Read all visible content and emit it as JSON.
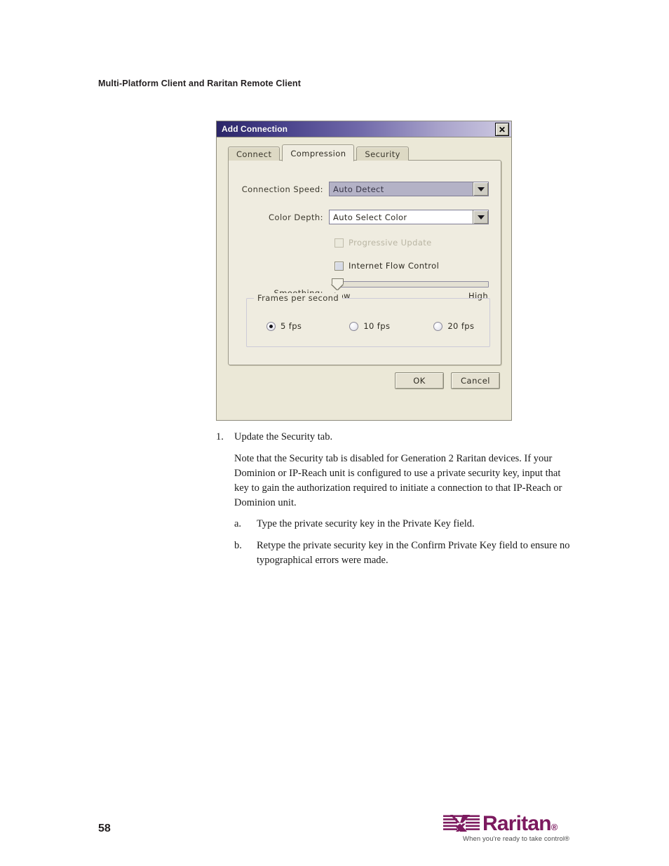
{
  "page": {
    "running_header": "Multi-Platform Client and Raritan Remote Client",
    "page_number": "58"
  },
  "dialog": {
    "title": "Add Connection",
    "close_label": "✕",
    "tabs": [
      {
        "label": "Connect",
        "active": false
      },
      {
        "label": "Compression",
        "active": true
      },
      {
        "label": "Security",
        "active": false
      }
    ],
    "fields": {
      "connection_speed": {
        "label": "Connection Speed:",
        "value": "Auto Detect",
        "state": "disabled"
      },
      "color_depth": {
        "label": "Color Depth:",
        "value": "Auto Select Color",
        "state": "enabled"
      }
    },
    "checkboxes": [
      {
        "label": "Progressive Update",
        "checked": false,
        "state": "disabled"
      },
      {
        "label": "Internet Flow Control",
        "checked": false,
        "state": "enabled"
      }
    ],
    "smoothing": {
      "label": "Smoothing:",
      "low_label": "Low",
      "high_label": "High",
      "value_percent": 0
    },
    "frames_group": {
      "title": "Frames per second",
      "options": [
        {
          "label": "5 fps",
          "selected": true
        },
        {
          "label": "10 fps",
          "selected": false
        },
        {
          "label": "20 fps",
          "selected": false
        }
      ]
    },
    "buttons": [
      {
        "label": "OK"
      },
      {
        "label": "Cancel"
      }
    ]
  },
  "body": {
    "step1_marker": "1.",
    "step1_text": "Update the Security tab.",
    "step1_note": "Note that the Security tab is disabled for Generation 2 Raritan devices. If your Dominion or IP-Reach unit is configured to use a private security key, input that key to gain the authorization required to initiate a connection to that IP-Reach or Dominion unit.",
    "sub_a_marker": "a.",
    "sub_a_text": "Type the private security key in the Private Key field.",
    "sub_b_marker": "b.",
    "sub_b_text": "Retype the private security key in the Confirm Private Key field to ensure no typographical errors were made."
  },
  "footer": {
    "brand_name": "Raritan",
    "brand_reg": "®",
    "tagline": "When you're ready to take control®",
    "brand_color": "#7c1a5f"
  }
}
